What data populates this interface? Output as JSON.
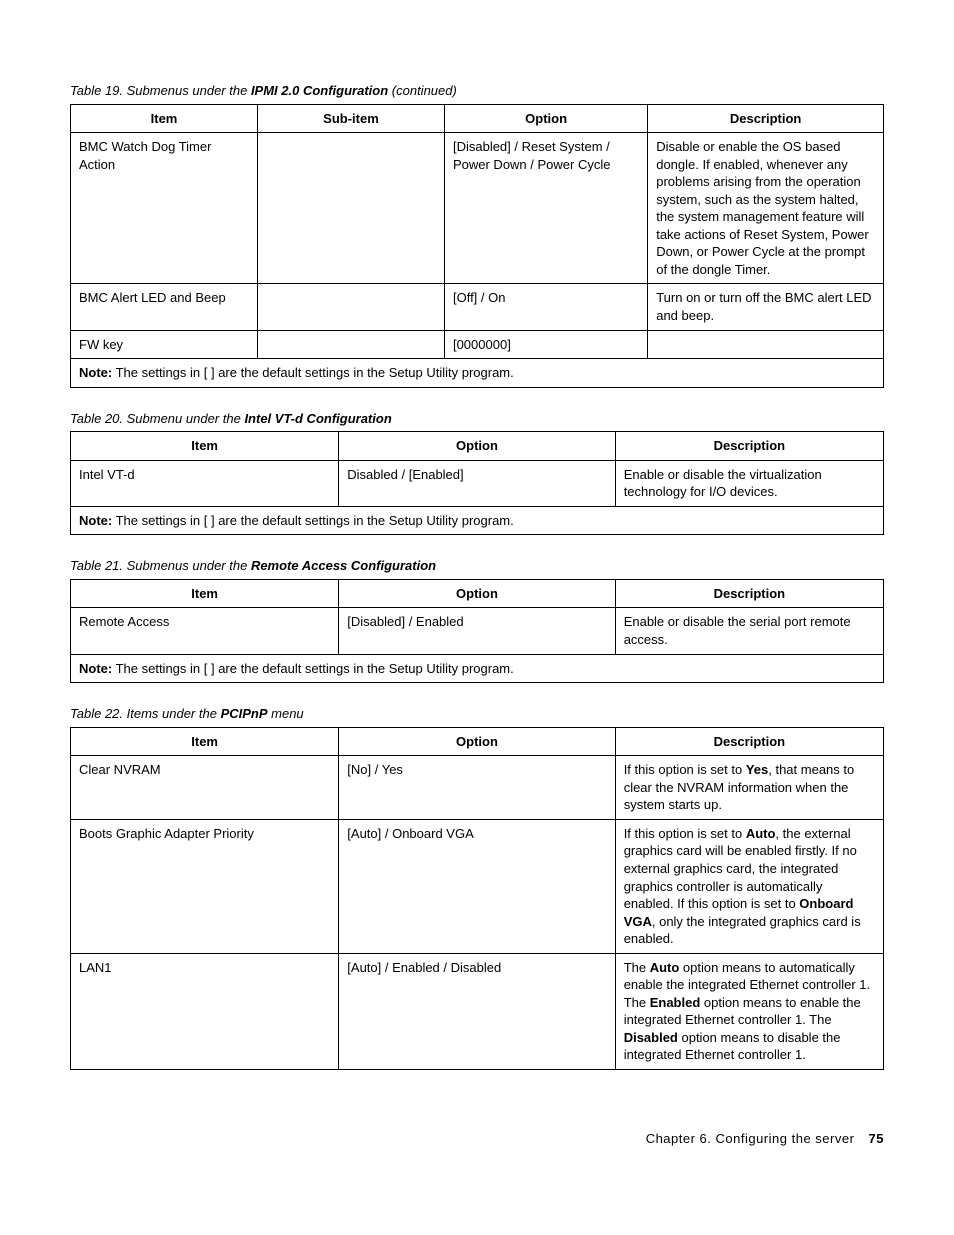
{
  "table19": {
    "caption_prefix": "Table 19.  Submenus under the ",
    "caption_bold": "IPMI 2.0 Configuration",
    "caption_suffix": " (continued)",
    "headers": {
      "item": "Item",
      "subitem": "Sub-item",
      "option": "Option",
      "description": "Description"
    },
    "rows": [
      {
        "item": "BMC Watch Dog Timer Action",
        "subitem": "",
        "option": "[Disabled] / Reset System / Power Down / Power Cycle",
        "description": "Disable or enable the OS based dongle. If enabled, whenever any problems arising from the operation system, such as the system halted, the system management feature will take actions of Reset System, Power Down, or Power Cycle at the prompt of the dongle Timer."
      },
      {
        "item": "BMC Alert LED and Beep",
        "subitem": "",
        "option": "[Off] / On",
        "description": "Turn on or turn off the BMC alert LED and beep."
      },
      {
        "item": "FW key",
        "subitem": "",
        "option": "[0000000]",
        "description": ""
      }
    ],
    "note_label": "Note:",
    "note_text": " The settings in [ ] are the default settings in the Setup Utility program."
  },
  "table20": {
    "caption_prefix": "Table 20.  Submenu under the ",
    "caption_bold": "Intel VT-d Configuration",
    "headers": {
      "item": "Item",
      "option": "Option",
      "description": "Description"
    },
    "rows": [
      {
        "item": "Intel VT-d",
        "option": "Disabled / [Enabled]",
        "description": "Enable or disable the virtualization technology for I/O devices."
      }
    ],
    "note_label": "Note:",
    "note_text": " The settings in [ ] are the default settings in the Setup Utility program."
  },
  "table21": {
    "caption_prefix": "Table 21.  Submenus under the ",
    "caption_bold": "Remote Access Configuration",
    "headers": {
      "item": "Item",
      "option": "Option",
      "description": "Description"
    },
    "rows": [
      {
        "item": "Remote Access",
        "option": "[Disabled] / Enabled",
        "description": "Enable or disable the serial port remote access."
      }
    ],
    "note_label": "Note:",
    "note_text": " The settings in [ ] are the default settings in the Setup Utility program."
  },
  "table22": {
    "caption_prefix": "Table 22.  Items under the ",
    "caption_bold": "PCIPnP",
    "caption_suffix": " menu",
    "headers": {
      "item": "Item",
      "option": "Option",
      "description": "Description"
    },
    "rows": [
      {
        "item": "Clear NVRAM",
        "option": "[No] / Yes",
        "desc_pre": "If this option is set to ",
        "desc_b1": "Yes",
        "desc_post": ", that means to clear the NVRAM information when the system starts up."
      },
      {
        "item": "Boots Graphic Adapter Priority",
        "option": "[Auto] / Onboard VGA",
        "desc_pre": "If this option is set to ",
        "desc_b1": "Auto",
        "desc_mid": ", the external graphics card will be enabled firstly. If no external graphics card, the integrated graphics controller is automatically enabled. If this option is set to ",
        "desc_b2": "Onboard VGA",
        "desc_post": ", only the integrated graphics card is enabled."
      },
      {
        "item": "LAN1",
        "option": "[Auto] / Enabled / Disabled",
        "desc_pre": "The ",
        "desc_b1": "Auto",
        "desc_mid1": " option means to automatically enable the integrated Ethernet controller 1. The ",
        "desc_b2": "Enabled",
        "desc_mid2": " option means to enable the integrated Ethernet controller 1. The ",
        "desc_b3": "Disabled",
        "desc_post": " option means to disable the integrated Ethernet controller 1."
      }
    ]
  },
  "footer": {
    "chapter": "Chapter 6.  Configuring the server",
    "page": "75"
  }
}
